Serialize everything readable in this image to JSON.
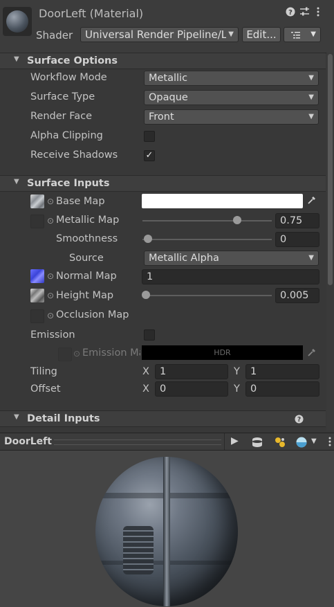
{
  "header": {
    "title": "DoorLeft (Material)",
    "shader_label": "Shader",
    "shader_value": "Universal Render Pipeline/Lit",
    "edit_label": "Edit...",
    "help_icon": "help-icon",
    "settings_icon": "sliders-icon",
    "more_icon": "kebab-menu-icon"
  },
  "surface_options": {
    "title": "Surface Options",
    "rows": {
      "workflow_mode": {
        "label": "Workflow Mode",
        "value": "Metallic"
      },
      "surface_type": {
        "label": "Surface Type",
        "value": "Opaque"
      },
      "render_face": {
        "label": "Render Face",
        "value": "Front"
      },
      "alpha_clipping": {
        "label": "Alpha Clipping",
        "checked": false
      },
      "receive_shadows": {
        "label": "Receive Shadows",
        "checked": true,
        "check_glyph": "✓"
      }
    }
  },
  "surface_inputs": {
    "title": "Surface Inputs",
    "base_map": {
      "label": "Base Map",
      "color": "#ffffff"
    },
    "metallic_map": {
      "label": "Metallic Map",
      "value": "0.75",
      "slider": 0.75
    },
    "smoothness": {
      "label": "Smoothness",
      "value": "0",
      "slider": 0
    },
    "source": {
      "label": "Source",
      "value": "Metallic Alpha"
    },
    "normal_map": {
      "label": "Normal Map",
      "value": "1"
    },
    "height_map": {
      "label": "Height Map",
      "value": "0.005",
      "slider": 0.0
    },
    "occlusion_map": {
      "label": "Occlusion Map"
    },
    "emission": {
      "label": "Emission",
      "checked": false
    },
    "emission_map": {
      "label": "Emission Map",
      "hdr_label": "HDR"
    },
    "tiling": {
      "label": "Tiling",
      "x_label": "X",
      "x": "1",
      "y_label": "Y",
      "y": "1"
    },
    "offset": {
      "label": "Offset",
      "x_label": "X",
      "x": "0",
      "y_label": "Y",
      "y": "0"
    }
  },
  "detail_inputs": {
    "title": "Detail Inputs"
  },
  "preview": {
    "title": "DoorLeft"
  }
}
